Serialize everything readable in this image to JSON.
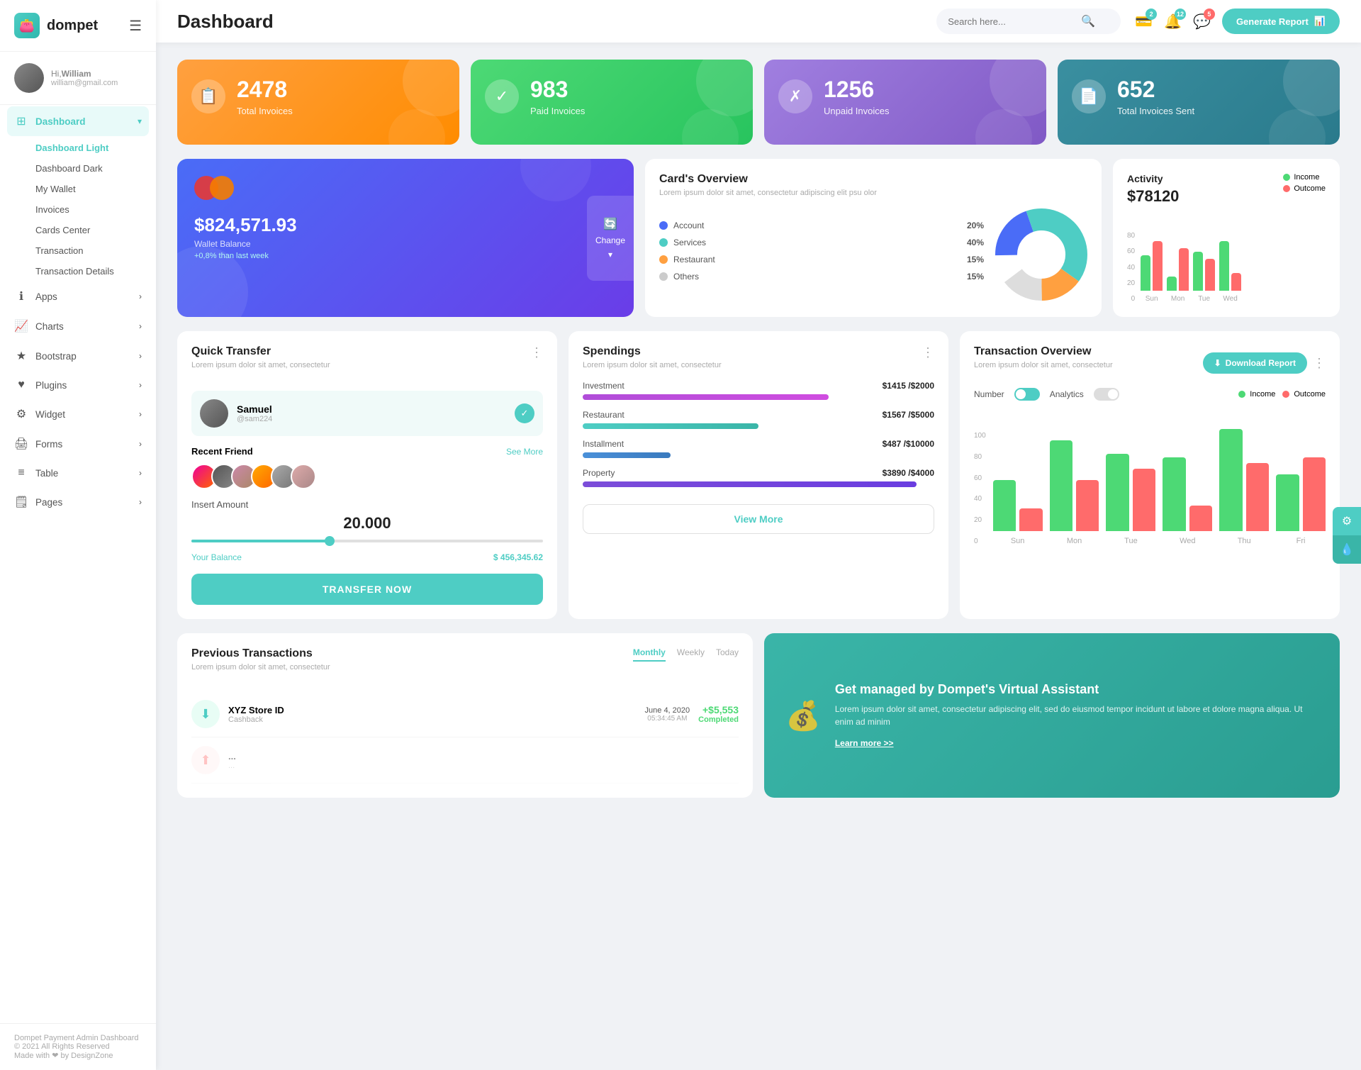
{
  "sidebar": {
    "logo": "dompet",
    "logo_emoji": "👛",
    "user": {
      "greeting": "Hi,",
      "name": "William",
      "email": "william@gmail.com"
    },
    "nav": [
      {
        "id": "dashboard",
        "icon": "⊞",
        "label": "Dashboard",
        "active": true,
        "arrow": true,
        "subitems": [
          "Dashboard Light",
          "Dashboard Dark",
          "My Wallet",
          "Invoices",
          "Cards Center",
          "Transaction",
          "Transaction Details"
        ]
      },
      {
        "id": "apps",
        "icon": "ℹ",
        "label": "Apps",
        "active": false,
        "arrow": true
      },
      {
        "id": "charts",
        "icon": "📈",
        "label": "Charts",
        "active": false,
        "arrow": true
      },
      {
        "id": "bootstrap",
        "icon": "★",
        "label": "Bootstrap",
        "active": false,
        "arrow": true
      },
      {
        "id": "plugins",
        "icon": "♥",
        "label": "Plugins",
        "active": false,
        "arrow": true
      },
      {
        "id": "widget",
        "icon": "⚙",
        "label": "Widget",
        "active": false,
        "arrow": true
      },
      {
        "id": "forms",
        "icon": "🖨",
        "label": "Forms",
        "active": false,
        "arrow": true
      },
      {
        "id": "table",
        "icon": "≡",
        "label": "Table",
        "active": false,
        "arrow": true
      },
      {
        "id": "pages",
        "icon": "🗒",
        "label": "Pages",
        "active": false,
        "arrow": true
      }
    ],
    "footer": {
      "brand": "Dompet Payment Admin Dashboard",
      "copyright": "© 2021 All Rights Reserved",
      "made_with": "Made with ❤ by DesignZone"
    }
  },
  "header": {
    "title": "Dashboard",
    "search_placeholder": "Search here...",
    "icons": [
      {
        "id": "wallet",
        "badge": "2"
      },
      {
        "id": "bell",
        "badge": "12"
      },
      {
        "id": "chat",
        "badge": "5"
      }
    ],
    "generate_btn": "Generate Report"
  },
  "stats": [
    {
      "id": "total",
      "number": "2478",
      "label": "Total Invoices",
      "icon": "📋",
      "color": "orange"
    },
    {
      "id": "paid",
      "number": "983",
      "label": "Paid Invoices",
      "icon": "✓",
      "color": "green"
    },
    {
      "id": "unpaid",
      "number": "1256",
      "label": "Unpaid Invoices",
      "icon": "✗",
      "color": "purple"
    },
    {
      "id": "sent",
      "number": "652",
      "label": "Total Invoices Sent",
      "icon": "📄",
      "color": "teal"
    }
  ],
  "wallet": {
    "amount": "$824,571.93",
    "label": "Wallet Balance",
    "change": "+0,8% than last week",
    "change_btn": "Change"
  },
  "cards_overview": {
    "title": "Card's Overview",
    "desc": "Lorem ipsum dolor sit amet, consectetur adipiscing elit psu olor",
    "items": [
      {
        "label": "Account",
        "color": "#4a6cf7",
        "pct": "20%"
      },
      {
        "label": "Services",
        "color": "#4ecdc4",
        "pct": "40%"
      },
      {
        "label": "Restaurant",
        "color": "#ffa040",
        "pct": "15%"
      },
      {
        "label": "Others",
        "color": "#ccc",
        "pct": "15%"
      }
    ]
  },
  "activity": {
    "title": "Activity",
    "amount": "$78120",
    "legend": [
      "Income",
      "Outcome"
    ],
    "bars": [
      {
        "day": "Sun",
        "income": 50,
        "outcome": 70
      },
      {
        "day": "Mon",
        "income": 20,
        "outcome": 60
      },
      {
        "day": "Tue",
        "income": 55,
        "outcome": 45
      },
      {
        "day": "Wed",
        "income": 70,
        "outcome": 25
      }
    ]
  },
  "quick_transfer": {
    "title": "Quick Transfer",
    "desc": "Lorem ipsum dolor sit amet, consectetur",
    "user": {
      "name": "Samuel",
      "handle": "@sam224"
    },
    "recent_label": "Recent Friend",
    "see_all": "See More",
    "amount_label": "Insert Amount",
    "amount": "20.000",
    "balance_label": "Your Balance",
    "balance": "$ 456,345.62",
    "btn": "TRANSFER NOW"
  },
  "spendings": {
    "title": "Spendings",
    "desc": "Lorem ipsum dolor sit amet, consectetur",
    "items": [
      {
        "label": "Investment",
        "amount": "$1415",
        "total": "$2000",
        "pct": 70,
        "color": "#b04dd9"
      },
      {
        "label": "Restaurant",
        "amount": "$1567",
        "total": "$5000",
        "pct": 50,
        "color": "#4ecdc4"
      },
      {
        "label": "Installment",
        "amount": "$487",
        "total": "$10000",
        "pct": 25,
        "color": "#4a90d9"
      },
      {
        "label": "Property",
        "amount": "$3890",
        "total": "$4000",
        "pct": 95,
        "color": "#7c4dd9"
      }
    ],
    "btn": "View More"
  },
  "trans_overview": {
    "title": "Transaction Overview",
    "desc": "Lorem ipsum dolor sit amet, consectetur",
    "dl_btn": "Download Report",
    "toggles": [
      "Number",
      "Analytics"
    ],
    "legend": [
      "Income",
      "Outcome"
    ],
    "bars": [
      {
        "day": "Sun",
        "income": 45,
        "outcome": 20
      },
      {
        "day": "Mon",
        "income": 80,
        "outcome": 45
      },
      {
        "day": "Tue",
        "income": 68,
        "outcome": 55
      },
      {
        "day": "Wed",
        "income": 65,
        "outcome": 22
      },
      {
        "day": "Thu",
        "income": 90,
        "outcome": 60
      },
      {
        "day": "Fri",
        "income": 50,
        "outcome": 65
      }
    ],
    "y_labels": [
      "100",
      "80",
      "60",
      "40",
      "20",
      "0"
    ]
  },
  "prev_transactions": {
    "title": "Previous Transactions",
    "desc": "Lorem ipsum dolor sit amet, consectetur",
    "tabs": [
      "Monthly",
      "Weekly",
      "Today"
    ],
    "items": [
      {
        "name": "XYZ Store ID",
        "type": "Cashback",
        "date": "June 4, 2020",
        "time": "05:34:45 AM",
        "amount": "+$5,553",
        "status": "Completed"
      }
    ]
  },
  "virtual_assistant": {
    "title": "Get managed by Dompet's Virtual Assistant",
    "desc": "Lorem ipsum dolor sit amet, consectetur adipiscing elit, sed do eiusmod tempor incidunt ut labore et dolore magna aliqua. Ut enim ad minim",
    "link": "Learn more >>"
  }
}
